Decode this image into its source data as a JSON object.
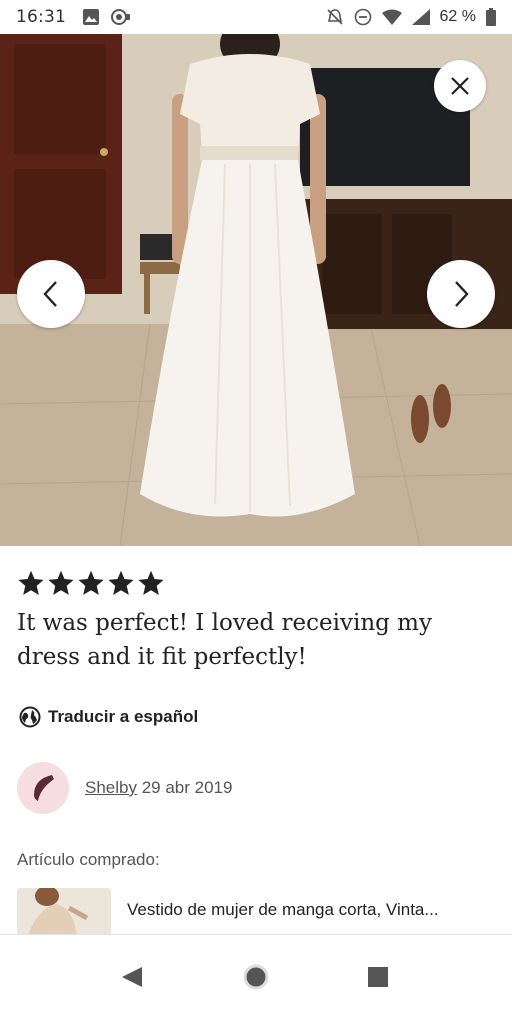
{
  "status_bar": {
    "time": "16:31",
    "battery": "62 %",
    "icons": [
      "image-icon",
      "whatsapp-icon",
      "mute-icon",
      "dnd-icon",
      "wifi-icon",
      "signal-icon",
      "battery-icon"
    ]
  },
  "gallery": {
    "close_icon": "close-icon",
    "prev_icon": "chevron-left-icon",
    "next_icon": "chevron-right-icon"
  },
  "review": {
    "rating": 5,
    "rating_max": 5,
    "text": "It was perfect! I loved receiving my dress and it fit perfectly!",
    "translate_label": "Traducir a español"
  },
  "author": {
    "name": "Shelby",
    "date": "29 abr 2019"
  },
  "purchased": {
    "label": "Artículo comprado:",
    "item_title": "Vestido de mujer de manga corta, Vinta..."
  },
  "nav": {
    "icons": [
      "back-icon",
      "home-icon",
      "recents-icon"
    ]
  },
  "colors": {
    "star": "#222222",
    "avatar_bg": "#f6dde2",
    "avatar_mark": "#5a2a3a"
  }
}
